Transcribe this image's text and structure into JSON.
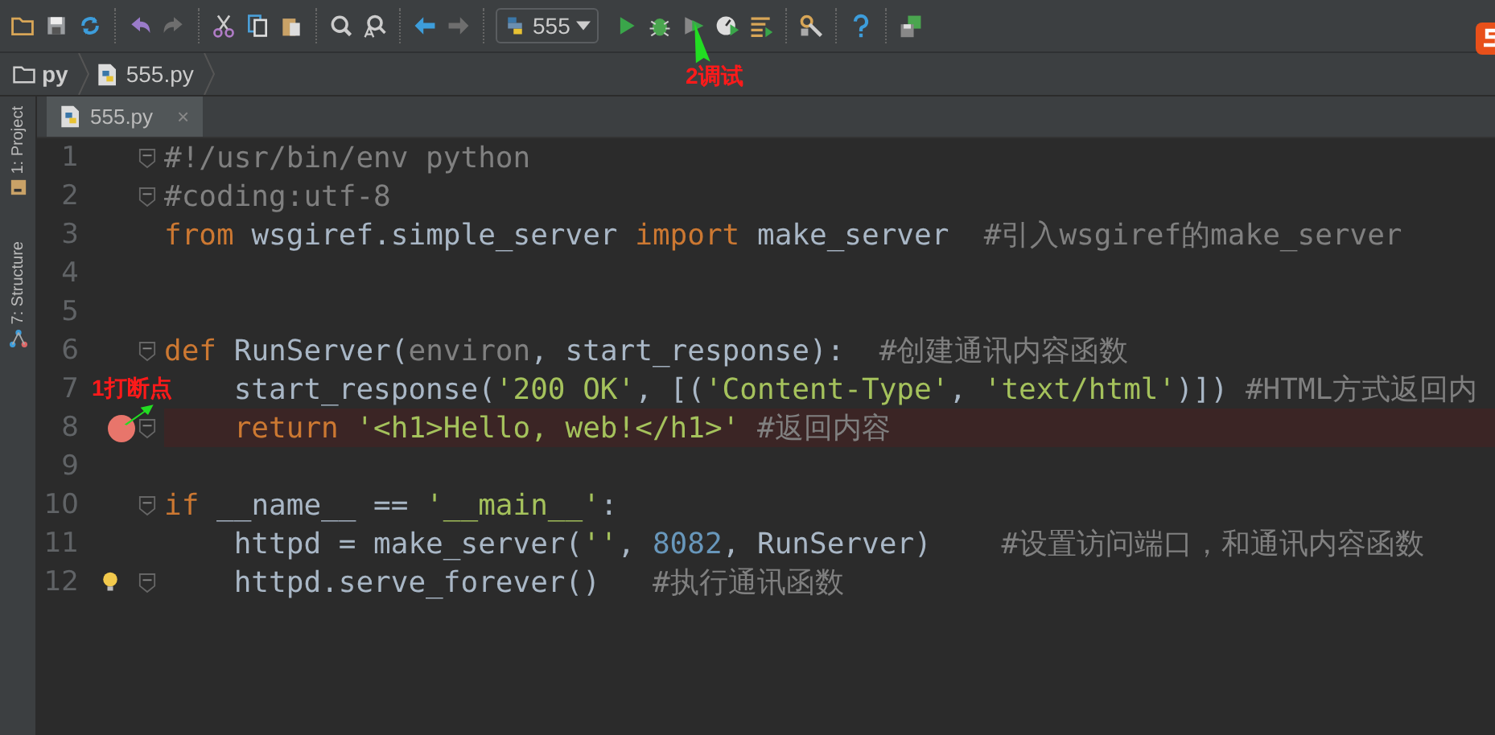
{
  "toolbar": {
    "run_config": "555"
  },
  "breadcrumb": [
    {
      "label": "py",
      "kind": "folder"
    },
    {
      "label": "555.py",
      "kind": "python"
    }
  ],
  "tabs": [
    {
      "label": "555.py",
      "close": "×",
      "selected": true
    }
  ],
  "tool_windows": [
    {
      "label": "1: Project",
      "kind": "project"
    },
    {
      "label": "7: Structure",
      "kind": "structure"
    }
  ],
  "editor": {
    "lines": [
      {
        "number": "1",
        "fold": true,
        "tokens": [
          {
            "text": "#!/usr/bin/env python",
            "kind": "comment"
          }
        ]
      },
      {
        "number": "2",
        "fold": true,
        "tokens": [
          {
            "text": "#coding:utf-8",
            "kind": "comment"
          }
        ]
      },
      {
        "number": "3",
        "tokens": [
          {
            "text": "from",
            "kind": "keyword"
          },
          {
            "text": " wsgiref.simple_server ",
            "kind": "plain"
          },
          {
            "text": "import",
            "kind": "keyword"
          },
          {
            "text": " make_server  ",
            "kind": "plain"
          },
          {
            "text": "#引入wsgiref的make_server",
            "kind": "comment"
          }
        ]
      },
      {
        "number": "4"
      },
      {
        "number": "5"
      },
      {
        "number": "6",
        "fold": true,
        "tokens": [
          {
            "text": "def",
            "kind": "keyword"
          },
          {
            "text": " RunServer(",
            "kind": "plain"
          },
          {
            "text": "environ",
            "kind": "unused"
          },
          {
            "text": ", start_response):  ",
            "kind": "plain"
          },
          {
            "text": "#创建通讯内容函数",
            "kind": "comment"
          }
        ]
      },
      {
        "number": "7",
        "tokens": [
          {
            "text": "    start_response(",
            "kind": "plain"
          },
          {
            "text": "'200 OK'",
            "kind": "string"
          },
          {
            "text": ", [(",
            "kind": "plain"
          },
          {
            "text": "'Content-Type'",
            "kind": "string"
          },
          {
            "text": ", ",
            "kind": "plain"
          },
          {
            "text": "'text/html'",
            "kind": "string"
          },
          {
            "text": ")]) ",
            "kind": "plain"
          },
          {
            "text": "#HTML方式返回内",
            "kind": "comment"
          }
        ]
      },
      {
        "number": "8",
        "fold": true,
        "breakpoint": true,
        "tokens": [
          {
            "text": "    return",
            "kind": "keyword"
          },
          {
            "text": " '<h1>Hello, web!</h1>'",
            "kind": "string"
          },
          {
            "text": " #返回内容",
            "kind": "comment"
          }
        ]
      },
      {
        "number": "9"
      },
      {
        "number": "10",
        "fold": true,
        "tokens": [
          {
            "text": "if",
            "kind": "keyword"
          },
          {
            "text": " __name__ == ",
            "kind": "plain"
          },
          {
            "text": "'__main__'",
            "kind": "string"
          },
          {
            "text": ":",
            "kind": "plain"
          }
        ]
      },
      {
        "number": "11",
        "tokens": [
          {
            "text": "    httpd = make_server(",
            "kind": "plain"
          },
          {
            "text": "''",
            "kind": "string"
          },
          {
            "text": ", ",
            "kind": "plain"
          },
          {
            "text": "8082",
            "kind": "number"
          },
          {
            "text": ", RunServer)    ",
            "kind": "plain"
          },
          {
            "text": "#设置访问端口，和通讯内容函数",
            "kind": "comment"
          }
        ]
      },
      {
        "number": "12",
        "fold": true,
        "bulb": true,
        "tokens": [
          {
            "text": "    httpd.serve_forever()   ",
            "kind": "plain"
          },
          {
            "text": "#执行通讯函数",
            "kind": "comment"
          }
        ]
      }
    ]
  },
  "annotations": [
    {
      "text": "1打断点",
      "kind": "breakpoint"
    },
    {
      "text": "2调试",
      "kind": "debug"
    }
  ]
}
